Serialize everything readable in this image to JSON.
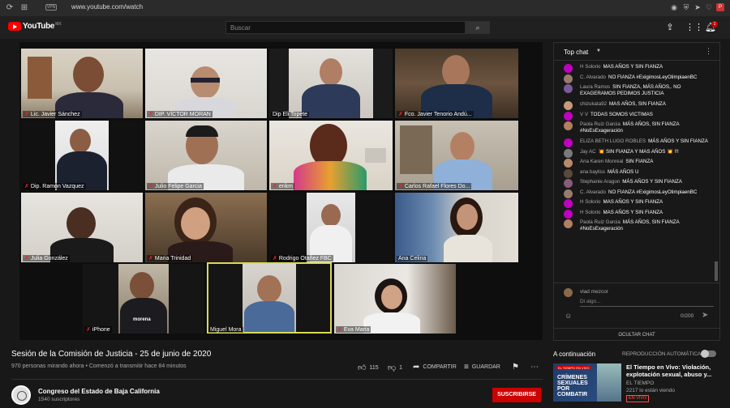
{
  "browser": {
    "url": "www.youtube.com/watch"
  },
  "header": {
    "logo_text": "YouTube",
    "logo_country": "MX",
    "search_placeholder": "Buscar",
    "notification_count": "1"
  },
  "video": {
    "title": "Sesión de la Comisión de Justicia - 25 de junio de 2020",
    "views": "970 personas mirando ahora • Comenzó a transmitir hace 84 minutos",
    "participants": [
      {
        "name": "Lic. Javier Sánchez",
        "muted": true
      },
      {
        "name": "DIP. VÍCTOR MORAN",
        "muted": true
      },
      {
        "name": "Dip Eli Topete",
        "muted": false
      },
      {
        "name": "Fco. Javier Tenorio Andú...",
        "muted": true
      },
      {
        "name": "Dip. Ramon Vazquez",
        "muted": true
      },
      {
        "name": "Julio Felipe Garcia",
        "muted": true
      },
      {
        "name": "erikm",
        "muted": true
      },
      {
        "name": "Carlos Rafael Flores Do...",
        "muted": true
      },
      {
        "name": "Julia González",
        "muted": true
      },
      {
        "name": "Maria Trinidad",
        "muted": true
      },
      {
        "name": "Rodrigo Otañez FBC",
        "muted": true
      },
      {
        "name": "Ana Celina",
        "muted": false
      },
      {
        "name": "iPhone",
        "muted": true
      },
      {
        "name": "Miguel Mora",
        "muted": false
      },
      {
        "name": "Eva Maria",
        "muted": true
      }
    ],
    "shirt_text": "morena"
  },
  "actions": {
    "likes": "115",
    "dislikes": "1",
    "share": "COMPARTIR",
    "save": "GUARDAR"
  },
  "channel": {
    "name": "Congreso del Estado de Baja California",
    "subscribers": "1540 suscriptores",
    "subscribe_label": "SUSCRIBIRSE"
  },
  "chat": {
    "title": "Top chat",
    "messages": [
      {
        "author": "H Solorio",
        "text": "MAS AÑOS Y SIN FIANZA",
        "color": "#c000c0"
      },
      {
        "author": "C. Alvarado",
        "text": "NO FIANZA #ExigimosLeyOlimpiaenBC",
        "color": "#9a7b6a"
      },
      {
        "author": "Laura Ramos",
        "text": "SIN FIANZA, MÁS AÑOS,. NO EXAGERAMOS PEDIMOS JUSTICIA",
        "color": "#7a5a9a"
      },
      {
        "author": "chizukata92",
        "text": "MAS AÑOS, SIN FIANZA",
        "color": "#c79a7a"
      },
      {
        "author": "V V",
        "text": "TODAS SOMOS VICTIMAS",
        "color": "#c000c0"
      },
      {
        "author": "Paola Ruiz Garcia",
        "text": "MÁS AÑOS, SIN FIANZA #NoEsExageración",
        "color": "#b08060"
      },
      {
        "author": "ELIZA BETH LUGO ROBLES",
        "text": "MÁS AÑOS Y SIN FIANZA",
        "color": "#c000c0"
      },
      {
        "author": "Jay AC",
        "text": "💥 SIN FIANZA Y MAS AÑOS 💥 !!!",
        "color": "#7a7a7a"
      },
      {
        "author": "Ana Karen Monreal",
        "text": "SIN FIANZA",
        "color": "#b98a6a"
      },
      {
        "author": "ana bayliss",
        "text": "MÁS AÑOS U",
        "color": "#5a4a3a"
      },
      {
        "author": "Stephanie Aragon",
        "text": "MÁS AÑOS Y SIN FIANZA",
        "color": "#8a5a7a"
      },
      {
        "author": "C. Alvarado",
        "text": "NO FIANZA #ExigimosLeyOlimpiaenBC",
        "color": "#9a7b6a"
      },
      {
        "author": "H Solorio",
        "text": "MAS AÑOS Y SIN FIANZA",
        "color": "#c000c0"
      },
      {
        "author": "H Solorio",
        "text": "MAS AÑOS Y SIN FIANZA",
        "color": "#c000c0"
      },
      {
        "author": "Paola Ruiz Garcia",
        "text": "MÁS AÑOS, SIN FIANZA #NoEsExageración",
        "color": "#b08060"
      }
    ],
    "input_user": "vlad mezcor",
    "input_placeholder": "Di algo...",
    "char_counter": "0/200",
    "hide_label": "OCULTAR CHAT"
  },
  "up_next": {
    "label": "A continuación",
    "autoplay_label": "REPRODUCCIÓN AUTOMÁTICA",
    "title": "El Tiempo en Vivo: Violación, explotación sexual, abuso y...",
    "channel": "EL TIEMPO",
    "viewers": "2217 lo están viendo",
    "live_badge": "EN VIVO",
    "thumb_badge": "EL TIEMPO EN VIVO",
    "thumb_text": "CRÍMENES SEXUALES POR COMBATIR"
  }
}
